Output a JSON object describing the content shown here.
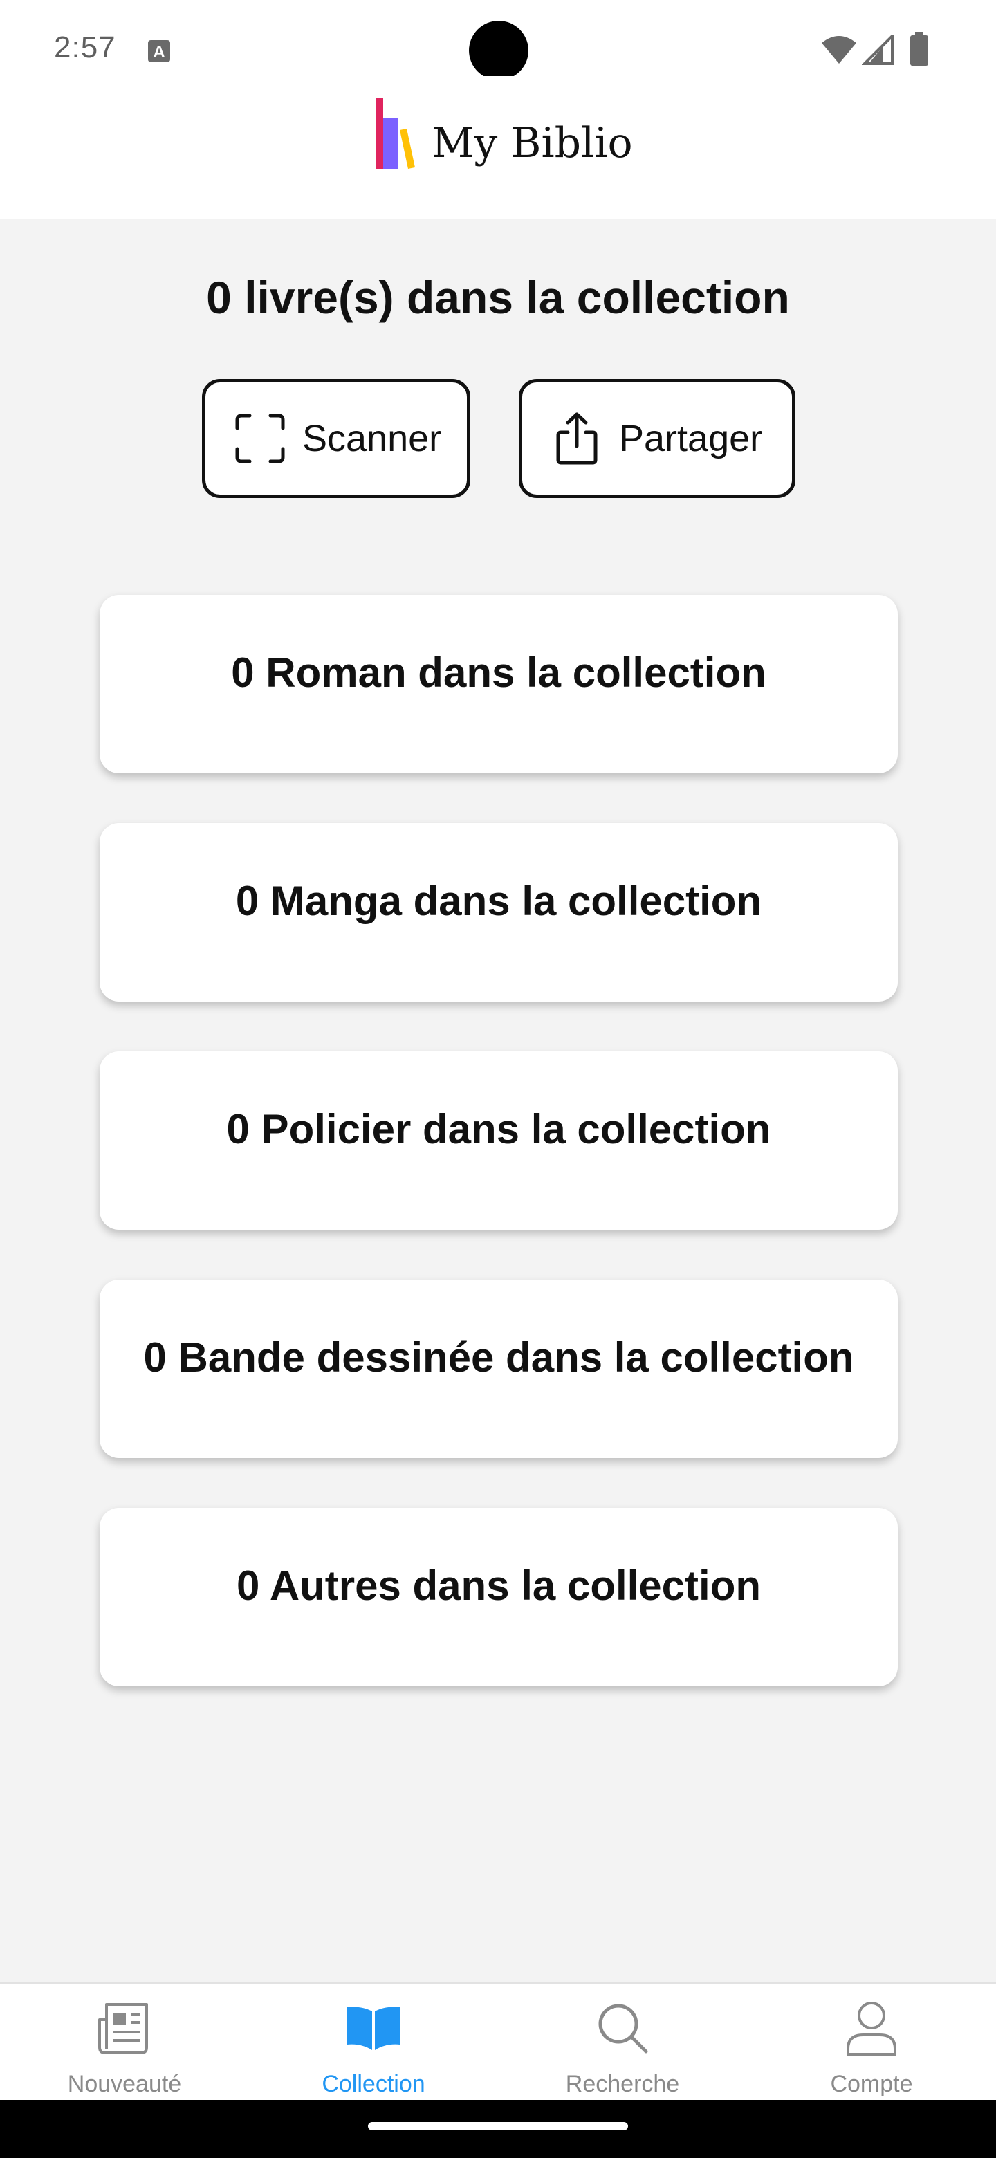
{
  "status_bar": {
    "time": "2:57",
    "icons": [
      "a-notification-icon",
      "wifi-icon",
      "signal-icon",
      "battery-icon"
    ]
  },
  "header": {
    "app_name": "My Biblio",
    "logo_colors": [
      "#e0245e",
      "#7b61ff",
      "#ffc107"
    ]
  },
  "collection": {
    "summary": "0 livre(s) dans la collection",
    "scan_label": "Scanner",
    "share_label": "Partager"
  },
  "categories": [
    {
      "label": "0 Roman dans la collection"
    },
    {
      "label": "0 Manga dans la collection"
    },
    {
      "label": "0 Policier dans la collection"
    },
    {
      "label": "0 Bande dessinée dans la collection"
    },
    {
      "label": "0 Autres dans la collection"
    }
  ],
  "nav": {
    "items": [
      {
        "label": "Nouveauté",
        "icon": "newspaper-icon"
      },
      {
        "label": "Collection",
        "icon": "open-book-icon",
        "active": true
      },
      {
        "label": "Recherche",
        "icon": "search-icon"
      },
      {
        "label": "Compte",
        "icon": "user-icon"
      }
    ],
    "active_color": "#2196f3",
    "inactive_color": "#8a8a8a"
  }
}
